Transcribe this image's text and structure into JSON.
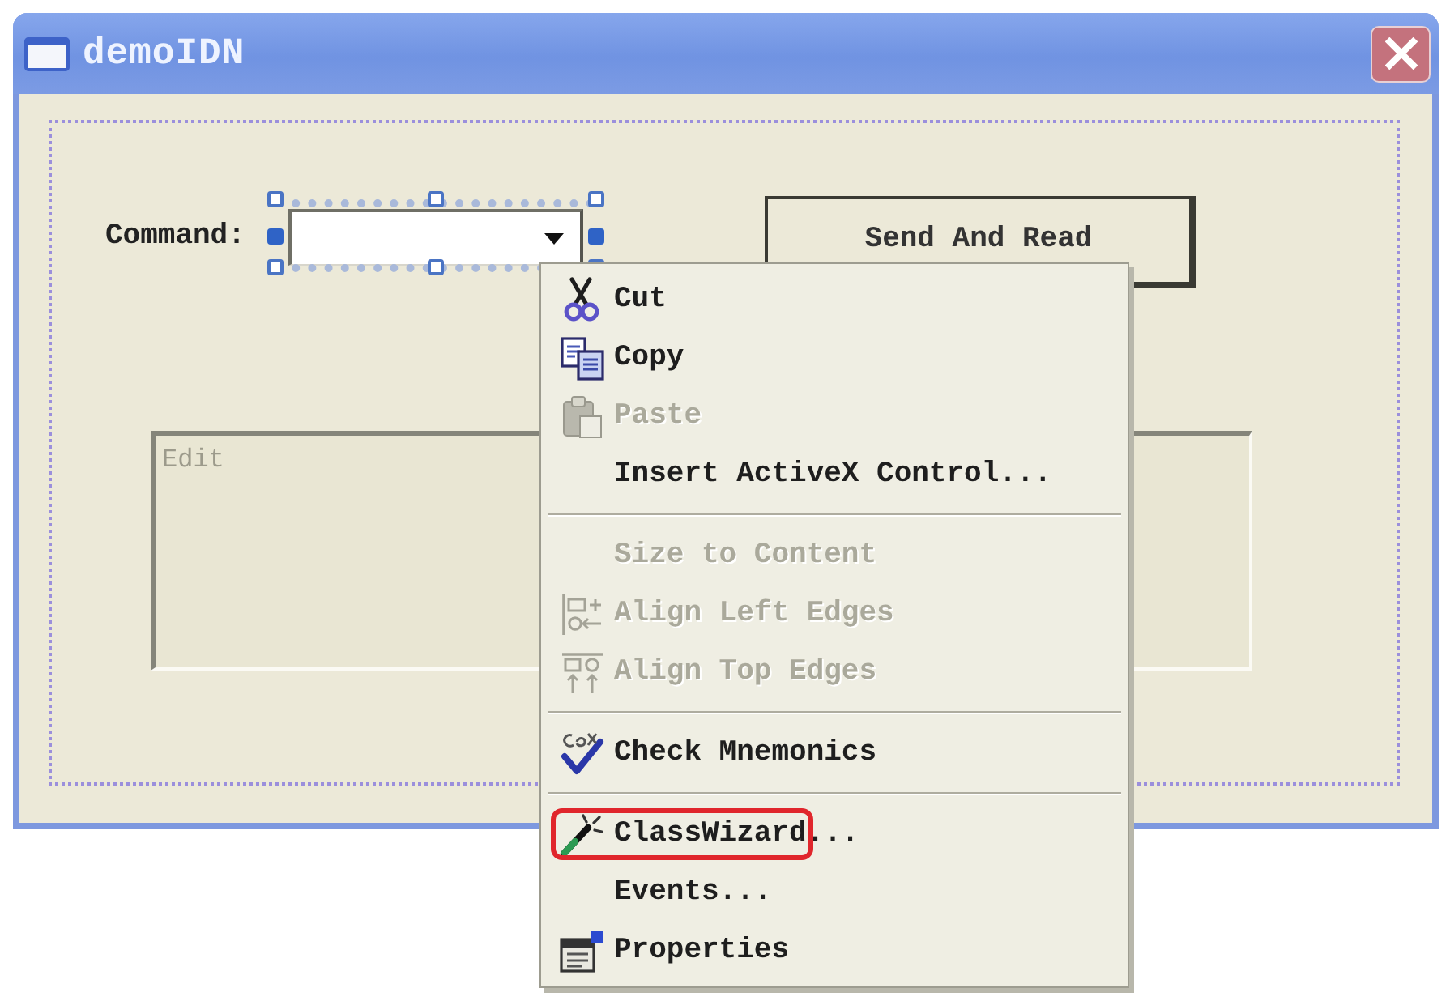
{
  "window": {
    "title": "demoIDN"
  },
  "dialog": {
    "command_label": "Command:",
    "command_combo": {
      "selected": true
    },
    "send_button": {
      "label": "Send And Read",
      "default": true
    },
    "edit_box": {
      "text": "Edit",
      "disabled": true
    }
  },
  "context_menu": {
    "groups": [
      [
        {
          "label": "Cut",
          "disabled": false,
          "highlighted": false
        },
        {
          "label": "Copy",
          "disabled": false,
          "highlighted": false
        },
        {
          "label": "Paste",
          "disabled": true,
          "highlighted": false
        },
        {
          "label": "Insert ActiveX Control...",
          "disabled": false,
          "highlighted": false
        }
      ],
      [
        {
          "label": "Size to Content",
          "disabled": true,
          "highlighted": false
        },
        {
          "label": "Align Left Edges",
          "disabled": true,
          "highlighted": false
        },
        {
          "label": "Align Top Edges",
          "disabled": true,
          "highlighted": false
        }
      ],
      [
        {
          "label": "Check Mnemonics",
          "disabled": false,
          "highlighted": false
        }
      ],
      [
        {
          "label": "ClassWizard",
          "suffix": "...",
          "disabled": false,
          "highlighted": true
        },
        {
          "label": "Events...",
          "disabled": false,
          "highlighted": false
        },
        {
          "label": "Properties",
          "disabled": false,
          "highlighted": false
        }
      ]
    ]
  }
}
